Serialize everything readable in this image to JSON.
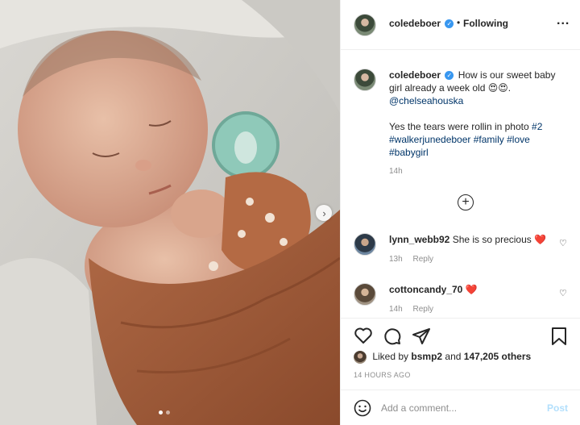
{
  "header": {
    "username": "coledeboer",
    "separator": "•",
    "follow_label": "Following",
    "more_label": "..."
  },
  "caption": {
    "username": "coledeboer",
    "text": "How is our sweet baby girl already a week old",
    "emoji": "😍😍.",
    "mention": "@chelseahouska",
    "line2": "Yes the tears were rollin in photo",
    "tag1": "#2",
    "tag2": "#walkerjunedeboer",
    "tag3": "#family",
    "tag4": "#love",
    "tag5": "#babygirl",
    "time": "14h"
  },
  "load_more_symbol": "+",
  "comments": [
    {
      "username": "lynn_webb92",
      "text": "She is so precious",
      "emoji": "❤️",
      "time": "13h",
      "reply": "Reply"
    },
    {
      "username": "cottoncandy_70",
      "text": "",
      "emoji": "❤️",
      "time": "14h",
      "reply": "Reply"
    }
  ],
  "likes": {
    "prefix": "Liked by",
    "user": "bsmp2",
    "middle": "and",
    "count": "147,205 others"
  },
  "timestamp": "14 HOURS AGO",
  "add_comment": {
    "placeholder": "Add a comment...",
    "post_label": "Post"
  },
  "icons": [
    "verified-badge-icon",
    "more-options-icon",
    "load-more-icon",
    "heart-icon",
    "comment-icon",
    "share-icon",
    "save-icon",
    "emoji-icon"
  ],
  "colors": {
    "link": "#003569",
    "verified": "#3897f0",
    "muted": "#8e8e8e",
    "heart": "#ed4956",
    "post_disabled": "#b2dffc"
  }
}
